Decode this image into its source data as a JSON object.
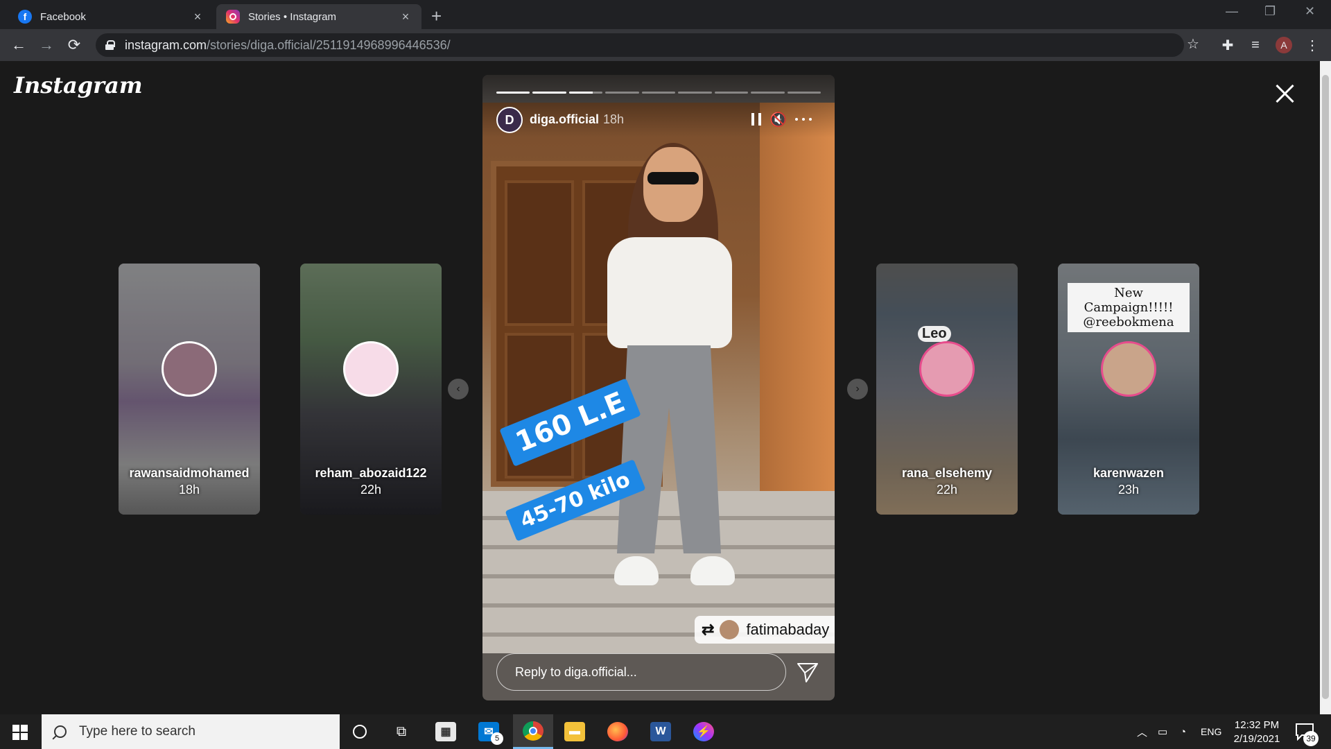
{
  "browser": {
    "tabs": [
      {
        "title": "Facebook",
        "favicon": "facebook-icon"
      },
      {
        "title": "Stories • Instagram",
        "favicon": "instagram-icon",
        "active": true
      }
    ],
    "url_host": "instagram.com",
    "url_path": "/stories/diga.official/2511914968996446536/",
    "profile_initial": "A"
  },
  "instagram": {
    "logo_text": "Instagram",
    "story": {
      "username": "diga.official",
      "time": "18h",
      "avatar_letter": "D",
      "segments_total": 9,
      "segments_complete": 2,
      "current_segment_progress": 0.7,
      "stickers": [
        "160 L.E",
        "45-70 kilo"
      ],
      "repost_user": "fatimabaday",
      "reply_placeholder": "Reply to diga.official..."
    },
    "side_stories": [
      {
        "name": "rawansaidmohamed",
        "time": "18h"
      },
      {
        "name": "reham_abozaid122",
        "time": "22h"
      },
      {
        "name": "rana_elsehemy",
        "time": "22h",
        "overlay_text": "Leo"
      },
      {
        "name": "karenwazen",
        "time": "23h",
        "overlay_text": "New Campaign!!!!! @reebokmena"
      }
    ]
  },
  "taskbar": {
    "search_placeholder": "Type here to search",
    "mail_badge": "5",
    "language": "ENG",
    "time": "12:32 PM",
    "date": "2/19/2021",
    "notification_count": "39"
  },
  "colors": {
    "accent_blue": "#1e88e5",
    "chrome_dark": "#202124",
    "chrome_toolbar": "#35363a"
  }
}
